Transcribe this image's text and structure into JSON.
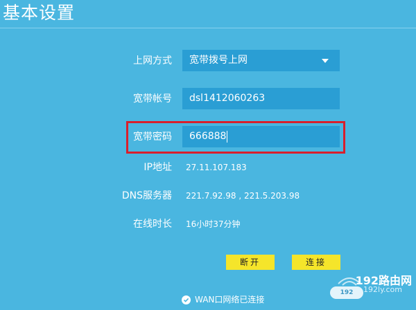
{
  "page": {
    "title": "基本设置"
  },
  "form": {
    "connection_type": {
      "label": "上网方式",
      "value": "宽带拨号上网"
    },
    "account": {
      "label": "宽带帐号",
      "value": "dsl1412060263"
    },
    "password": {
      "label": "宽带密码",
      "value": "666888"
    },
    "ip": {
      "label": "IP地址",
      "value": "27.11.107.183"
    },
    "dns": {
      "label": "DNS服务器",
      "value": "221.7.92.98 , 221.5.203.98"
    },
    "uptime": {
      "label": "在线时长",
      "value": "16小时37分钟"
    }
  },
  "buttons": {
    "disconnect": "断开",
    "connect": "连接"
  },
  "status": {
    "text": "WAN口网络已连接"
  },
  "watermark": {
    "main": "192路由网",
    "sub": "192ly.com",
    "badge": "192"
  },
  "colors": {
    "background": "#4ab6e0",
    "field": "#2a9ed4",
    "highlight": "#d91f2c",
    "button": "#f5e52a"
  },
  "icons": {
    "dropdown": "chevron-down-icon",
    "status": "check-circle-icon"
  }
}
